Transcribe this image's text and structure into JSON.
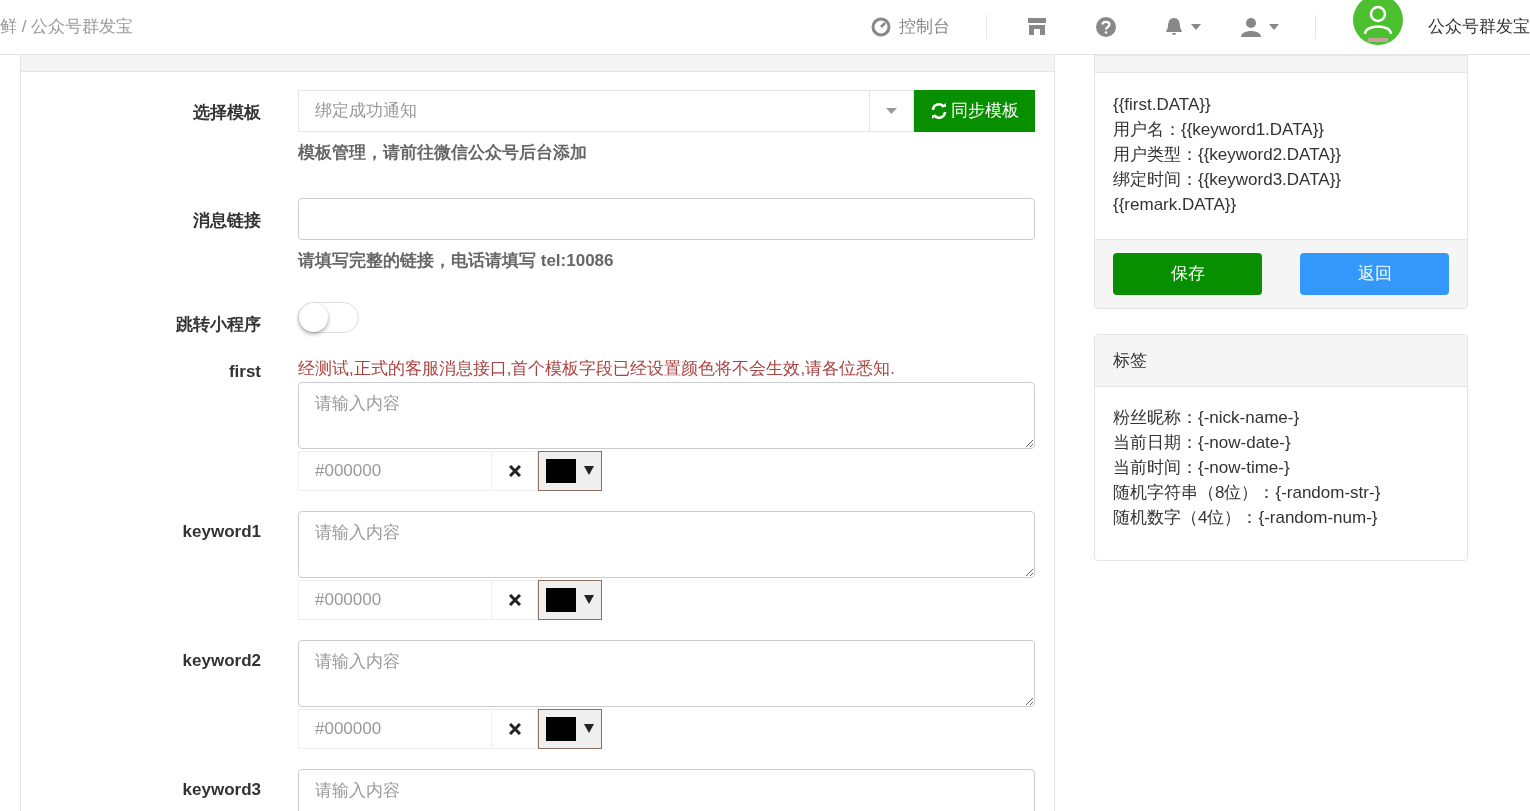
{
  "header": {
    "breadcrumb": "鲜 / 公众号群发宝",
    "console": "控制台",
    "app_name": "公众号群发宝"
  },
  "form": {
    "template": {
      "label": "选择模板",
      "value": "绑定成功通知",
      "sync_button": "同步模板",
      "help": "模板管理，请前往微信公众号后台添加"
    },
    "link": {
      "label": "消息链接",
      "help": "请填写完整的链接，电话请填写 tel:10086"
    },
    "miniprogram": {
      "label": "跳转小程序",
      "on": false
    },
    "fields": [
      {
        "label": "first",
        "note": "经测试,正式的客服消息接口,首个模板字段已经设置颜色将不会生效,请各位悉知.",
        "placeholder": "请输入内容",
        "color_value": "#000000",
        "color": "#000000"
      },
      {
        "label": "keyword1",
        "placeholder": "请输入内容",
        "color_value": "#000000",
        "color": "#000000"
      },
      {
        "label": "keyword2",
        "placeholder": "请输入内容",
        "color_value": "#000000",
        "color": "#000000"
      },
      {
        "label": "keyword3",
        "placeholder": "请输入内容"
      }
    ]
  },
  "preview": {
    "lines": [
      "{{first.DATA}}",
      "用户名：{{keyword1.DATA}}",
      "用户类型：{{keyword2.DATA}}",
      "绑定时间：{{keyword3.DATA}}",
      "{{remark.DATA}}"
    ],
    "save_button": "保存",
    "back_button": "返回"
  },
  "tags": {
    "title": "标签",
    "lines": [
      "粉丝昵称：{-nick-name-}",
      "当前日期：{-now-date-}",
      "当前时间：{-now-time-}",
      "随机字符串（8位）：{-random-str-}",
      "随机数字（4位）：{-random-num-}"
    ]
  }
}
